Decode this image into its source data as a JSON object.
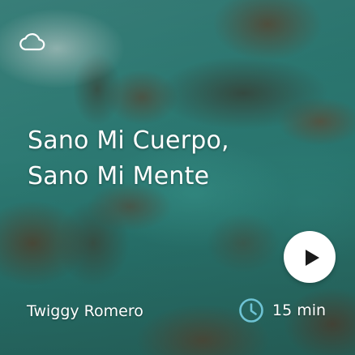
{
  "card": {
    "title_line1": "Sano Mi Cuerpo,",
    "title_line2": "Sano Mi Mente",
    "author": "Twiggy Romero",
    "duration": "15 min",
    "icons": {
      "top_left": "cloud-icon",
      "action": "play-icon",
      "duration": "clock-icon"
    },
    "colors": {
      "text": "#ffffff",
      "play_button_bg": "#ffffff",
      "play_glyph": "#1a1a1a",
      "clock_accent": "#6ec3d4"
    }
  }
}
